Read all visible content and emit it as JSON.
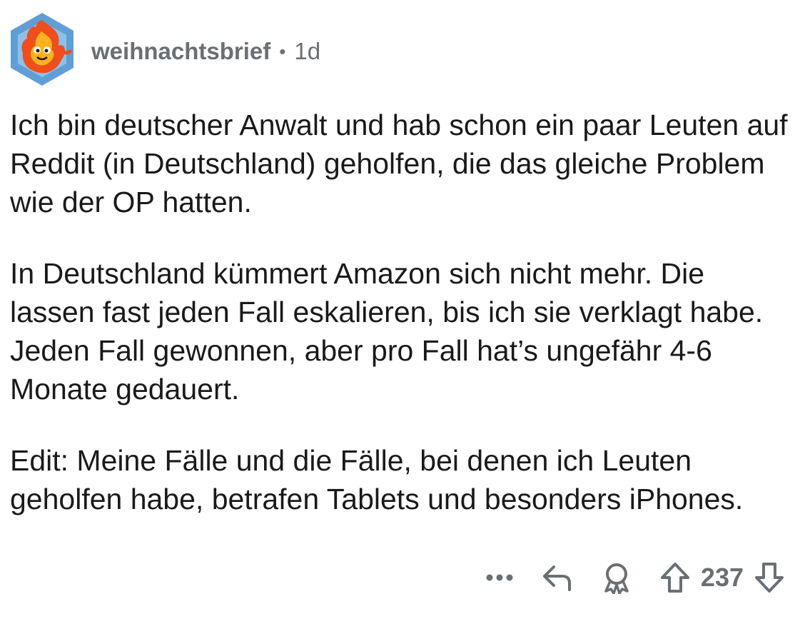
{
  "comment": {
    "author": "weihnachtsbrief",
    "separator": "•",
    "age": "1d",
    "avatar_icon": "fire-mascot-avatar-icon",
    "paragraphs": [
      "Ich bin deutscher Anwalt und hab schon ein paar Leuten auf Reddit (in Deutschland) geholfen, die das gleiche Problem wie der OP hatten.",
      "In Deutschland kümmert Amazon sich nicht mehr. Die lassen fast jeden Fall eskalieren, bis ich sie verklagt habe. Jeden Fall gewonnen, aber pro Fall hat’s ungefähr 4-6 Monate gedauert.",
      "Edit: Meine Fälle und die Fälle, bei denen ich Leuten geholfen habe, betrafen Tablets und besonders iPhones."
    ]
  },
  "actions": {
    "more_icon": "more-dots-icon",
    "reply_icon": "reply-icon",
    "award_icon": "award-icon",
    "upvote_icon": "upvote-icon",
    "downvote_icon": "downvote-icon",
    "vote_count": "237"
  },
  "colors": {
    "text": "#1a1a1b",
    "meta": "#6b6f73",
    "icon": "#6b6f73",
    "avatar_bg": "#5f9fd6",
    "avatar_fire": "#f04e1a"
  }
}
